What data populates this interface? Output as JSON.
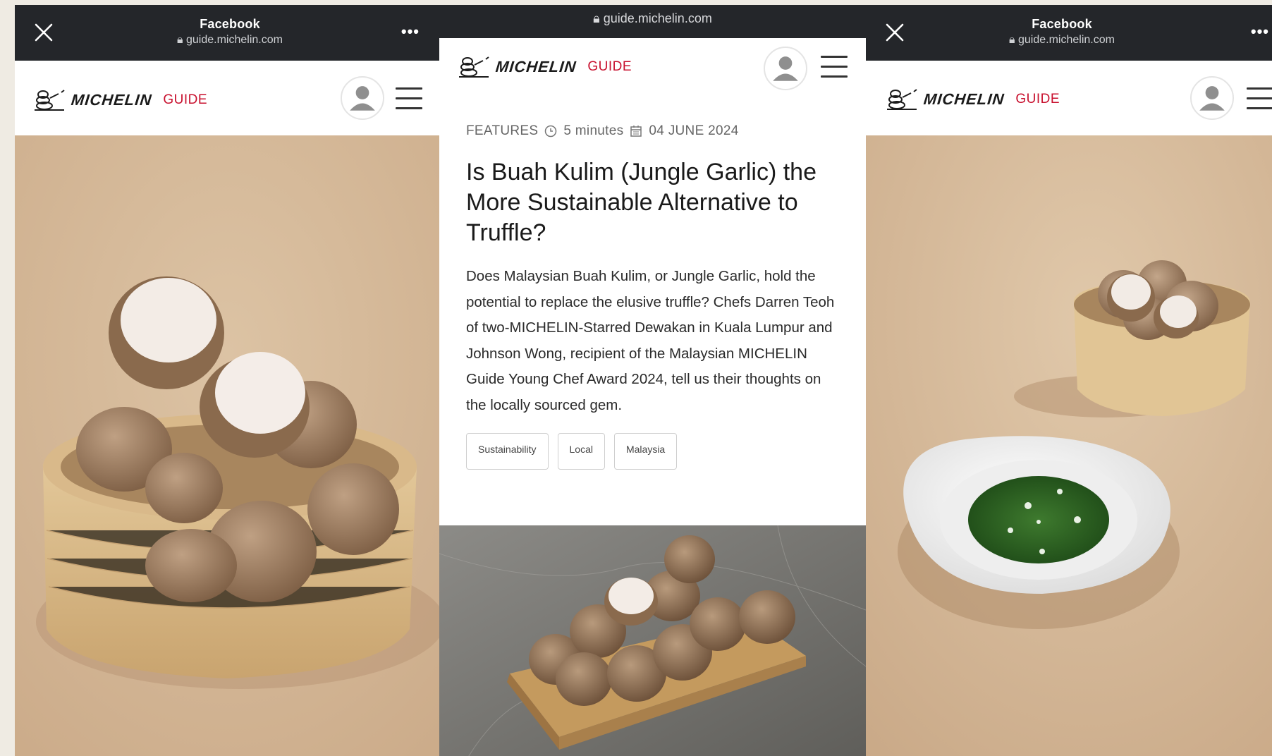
{
  "panel_left": {
    "fb_title": "Facebook",
    "fb_url": "guide.michelin.com",
    "close_icon": "close-icon",
    "more_label": "•••",
    "logo_word": "MICHELIN",
    "logo_guide": "GUIDE"
  },
  "panel_middle": {
    "url": "guide.michelin.com",
    "logo_word": "MICHELIN",
    "logo_guide": "GUIDE",
    "category": "FEATURES",
    "read_time": "5 minutes",
    "date": "04 JUNE 2024",
    "headline": "Is Buah Kulim (Jungle Garlic) the More Sustainable Alternative to Truffle?",
    "summary": "Does Malaysian Buah Kulim, or Jungle Garlic, hold the potential to replace the elusive truffle? Chefs Darren Teoh of two-MICHELIN-Starred Dewakan in Kuala Lumpur and Johnson Wong, recipient of the Malaysian MICHELIN Guide Young Chef Award 2024, tell us their thoughts on the locally sourced gem.",
    "tags": [
      "Sustainability",
      "Local",
      "Malaysia"
    ]
  },
  "panel_right": {
    "fb_title": "Facebook",
    "fb_url": "guide.michelin.com",
    "more_label": "•••",
    "logo_word": "MICHELIN",
    "logo_guide": "GUIDE"
  },
  "colors": {
    "bar_bg": "#24262a",
    "brand_red": "#c8102e",
    "backdrop": "#d6bb9a"
  }
}
